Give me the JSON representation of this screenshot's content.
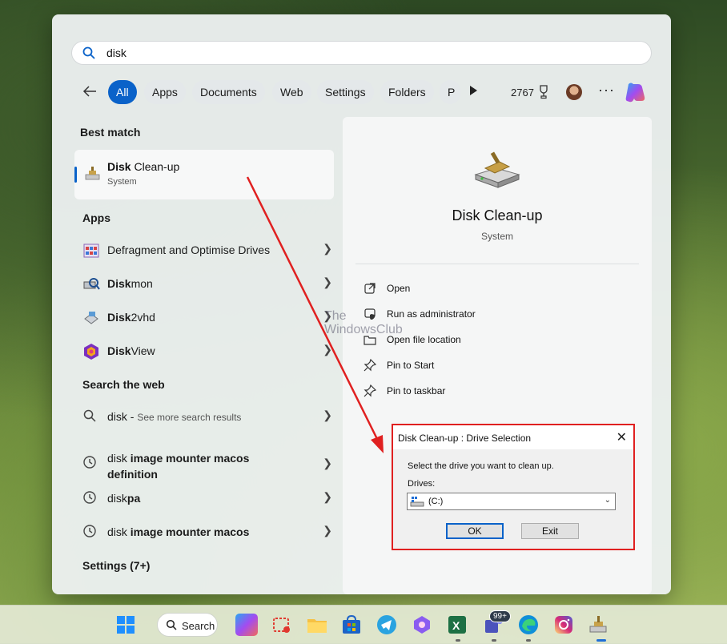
{
  "search": {
    "query": "disk"
  },
  "filters": {
    "chips": [
      "All",
      "Apps",
      "Documents",
      "Web",
      "Settings",
      "Folders",
      "P"
    ],
    "points": "2767"
  },
  "left": {
    "best_match_title": "Best match",
    "best_match": {
      "name_bold": "Disk",
      "name_rest": " Clean-up",
      "sub": "System"
    },
    "apps_title": "Apps",
    "apps": [
      {
        "bold": "",
        "rest": "Defragment and Optimise Drives",
        "icon": "defrag-icon"
      },
      {
        "bold": "Disk",
        "rest": "mon",
        "icon": "diskmon-icon"
      },
      {
        "bold": "Disk",
        "rest": "2vhd",
        "icon": "disk2vhd-icon"
      },
      {
        "bold": "Disk",
        "rest": "View",
        "icon": "diskview-icon"
      }
    ],
    "web_title": "Search the web",
    "web": [
      {
        "bold": "disk",
        "rest": " - ",
        "muted": "See more search results"
      },
      {
        "bold": "disk",
        "rest": " image mounter macos",
        "line2": "definition"
      },
      {
        "bold": "disk",
        "rest": "pa"
      },
      {
        "bold": "disk",
        "rest": " image mounter macos"
      }
    ],
    "settings_title": "Settings (7+)"
  },
  "right": {
    "title": "Disk Clean-up",
    "sub": "System",
    "actions": [
      "Open",
      "Run as administrator",
      "Open file location",
      "Pin to Start",
      "Pin to taskbar"
    ]
  },
  "watermark": {
    "line1": "The",
    "line2": "WindowsClub"
  },
  "dialog": {
    "title": "Disk Clean-up : Drive Selection",
    "prompt": "Select the drive you want to clean up.",
    "drives_label": "Drives:",
    "drive_value": "(C:)",
    "ok_label": "OK",
    "exit_label": "Exit"
  },
  "taskbar": {
    "search_label": "Search",
    "badge": "99+"
  },
  "colors": {
    "accent": "#0a62c9",
    "highlight_red": "#e02020"
  }
}
